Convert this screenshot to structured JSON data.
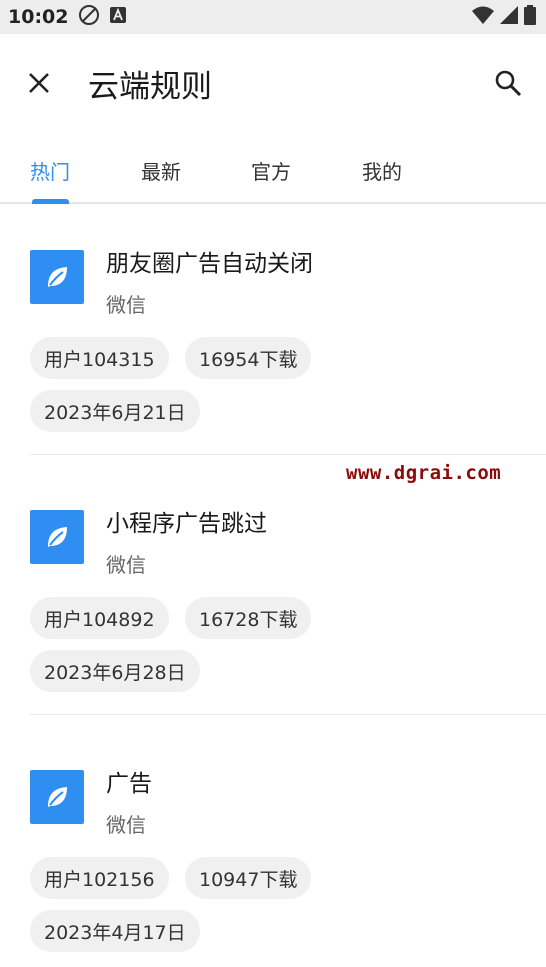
{
  "status": {
    "time": "10:02"
  },
  "header": {
    "title": "云端规则"
  },
  "tabs": [
    {
      "label": "热门",
      "active": true
    },
    {
      "label": "最新",
      "active": false
    },
    {
      "label": "官方",
      "active": false
    },
    {
      "label": "我的",
      "active": false
    }
  ],
  "rules": [
    {
      "name": "朋友圈广告自动关闭",
      "app": "微信",
      "user": "用户104315",
      "downloads": "16954下载",
      "date": "2023年6月21日"
    },
    {
      "name": "小程序广告跳过",
      "app": "微信",
      "user": "用户104892",
      "downloads": "16728下载",
      "date": "2023年6月28日"
    },
    {
      "name": "广告",
      "app": "微信",
      "user": "用户102156",
      "downloads": "10947下载",
      "date": "2023年4月17日"
    }
  ],
  "watermark": "www.dgrai.com",
  "colors": {
    "accent": "#2f8ef2",
    "status_bar": "#ededed",
    "chip_bg": "#f0f0f0",
    "watermark": "#8b0a0a"
  },
  "icons": {
    "close": "close-icon",
    "search": "search-icon",
    "rule": "leaf-icon"
  }
}
